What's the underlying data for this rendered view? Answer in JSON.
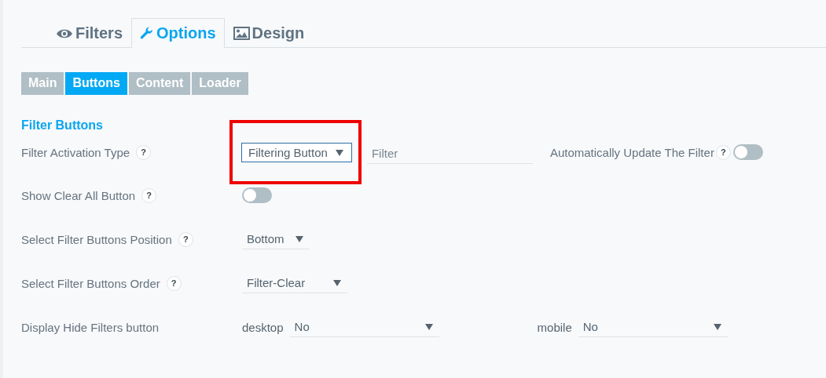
{
  "tabs": [
    {
      "label": "Filters",
      "kind": "eye",
      "selected": false
    },
    {
      "label": "Options",
      "kind": "wrench",
      "selected": true
    },
    {
      "label": "Design",
      "kind": "image",
      "selected": false
    }
  ],
  "subtabs": [
    {
      "label": "Main",
      "selected": false
    },
    {
      "label": "Buttons",
      "selected": true
    },
    {
      "label": "Content",
      "selected": false
    },
    {
      "label": "Loader",
      "selected": false
    }
  ],
  "section_title": "Filter Buttons",
  "rows": [
    {
      "kind": "activation",
      "label": "Filter Activation Type",
      "help": "?",
      "select": {
        "value": "Filtering Button",
        "highlighted": true
      },
      "text_value": "Filter",
      "toggle_label": "Automatically Update The Filter",
      "toggle_help": "?",
      "toggle_on": false
    },
    {
      "kind": "toggle",
      "label": "Show Clear All Button",
      "help": "?",
      "on": false
    },
    {
      "kind": "select",
      "label": "Select Filter Buttons Position",
      "help": "?",
      "value": "Bottom"
    },
    {
      "kind": "select",
      "label": "Select Filter Buttons Order",
      "help": "?",
      "value": "Filter-Clear"
    },
    {
      "kind": "devices",
      "label": "Display Hide Filters button",
      "devices": [
        {
          "label": "desktop",
          "value": "No"
        },
        {
          "label": "mobile",
          "value": "No"
        }
      ]
    }
  ]
}
